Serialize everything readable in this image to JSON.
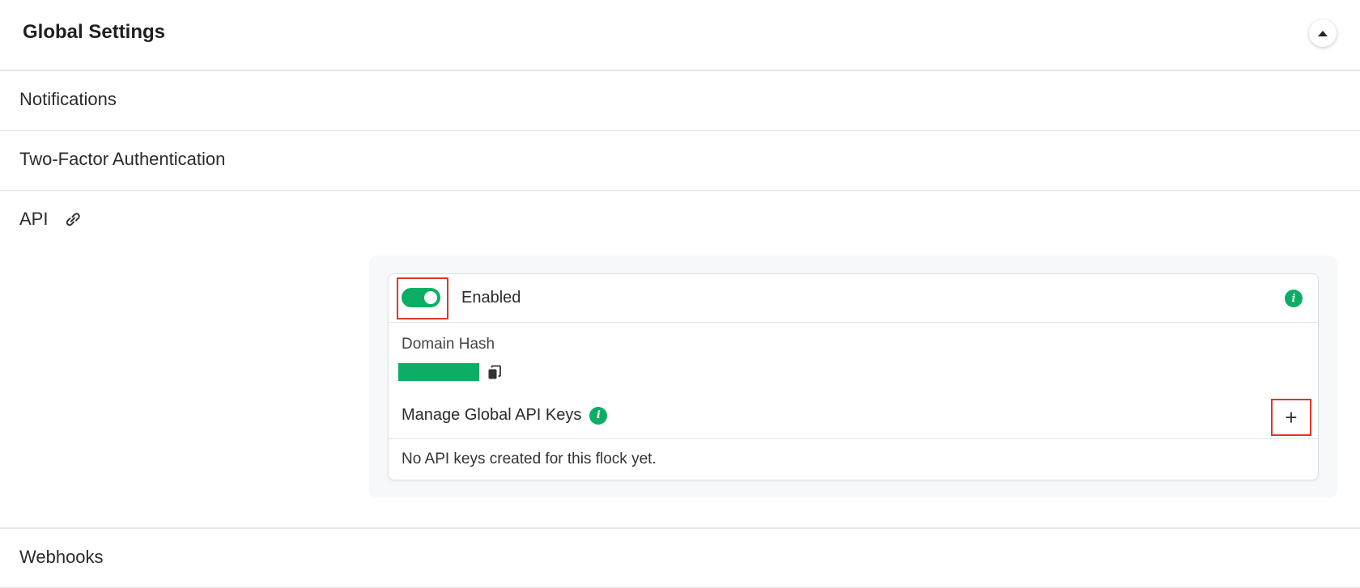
{
  "header": {
    "title": "Global Settings",
    "collapse_icon": "caret-up-icon"
  },
  "sections": {
    "notifications": "Notifications",
    "two_factor": "Two-Factor Authentication",
    "api": "API",
    "webhooks": "Webhooks"
  },
  "api": {
    "link_icon": "link-icon",
    "toggle": {
      "state": "on",
      "label": "Enabled"
    },
    "domain_hash_label": "Domain Hash",
    "manage_keys_label": "Manage Global API Keys",
    "add_button_label": "+",
    "empty_message": "No API keys created for this flock yet."
  },
  "colors": {
    "accent": "#0cae66",
    "highlight": "#e4332a"
  }
}
